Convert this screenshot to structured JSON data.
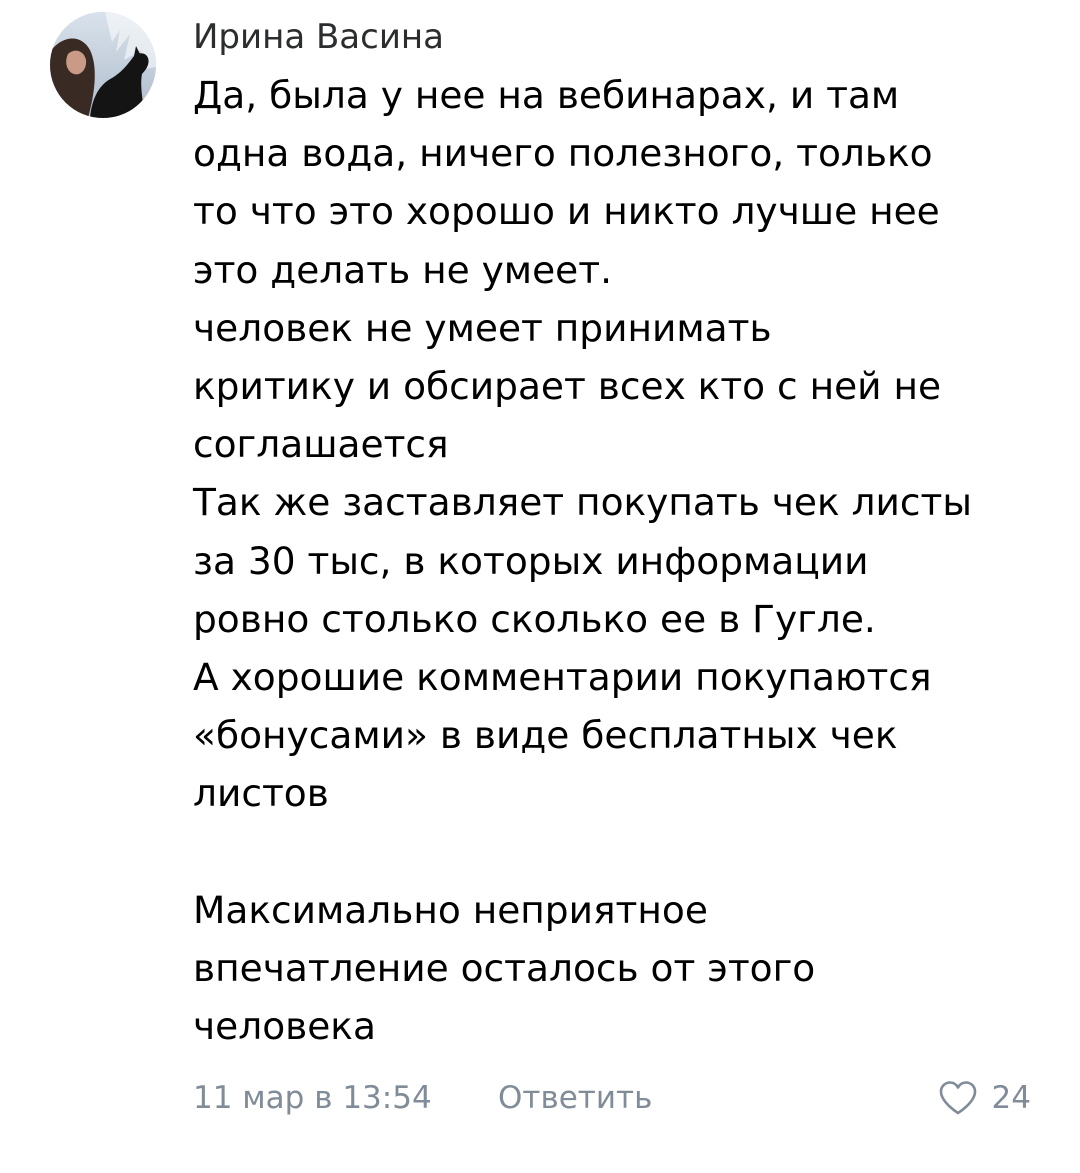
{
  "comment": {
    "author": "Ирина Васина",
    "avatar_icon": "user-avatar",
    "text_lines": [
      "Да, была у нее на вебинарах, и там",
      "одна вода, ничего полезного, только",
      "то что это хорошо и никто лучше нее",
      "это делать не умеет.",
      "человек не умеет принимать",
      "критику и обсирает всех кто с ней не",
      "соглашается",
      "Так же заставляет покупать чек листы",
      "за 30 тыс, в которых информации",
      "ровно столько сколько ее в Гугле.",
      "А хорошие комментарии покупаются",
      "«бонусами» в виде бесплатных чек",
      "листов",
      "",
      "Максимально неприятное",
      "впечатление осталось от этого",
      "человека"
    ],
    "date": "11 мар в 13:54",
    "reply_label": "Ответить",
    "like_icon": "heart-icon",
    "like_count": "24",
    "colors": {
      "author": "#2c2d2e",
      "text": "#000000",
      "meta": "#818c99"
    }
  }
}
